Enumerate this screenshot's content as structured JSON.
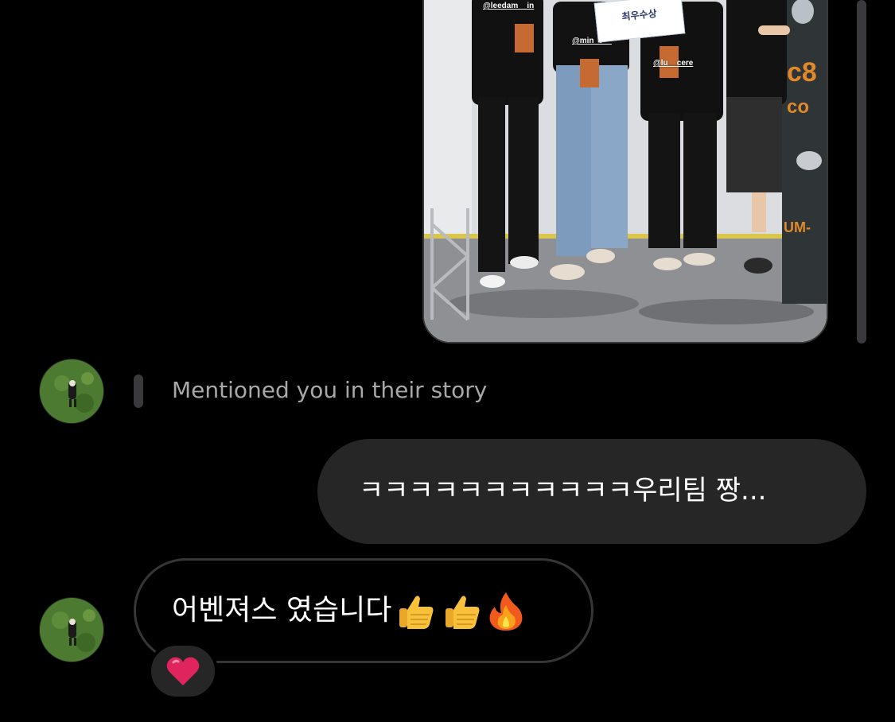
{
  "story": {
    "tags": [
      "@leedam__in",
      "@min_0__",
      "@lu__cere"
    ],
    "sign_text": "최우수상"
  },
  "mention": {
    "text": "Mentioned you in their story"
  },
  "messages": {
    "outgoing_text": "ㅋㅋㅋㅋㅋㅋㅋㅋㅋㅋㅋ우리팀 짱...",
    "incoming_text": "어벤져스 였습니다",
    "incoming_emojis": [
      "thumbs-up-icon",
      "thumbs-up-icon",
      "fire-icon"
    ],
    "reaction": "heart-icon"
  },
  "colors": {
    "background": "#000000",
    "bubble_out": "#262626",
    "bubble_in_border": "#363636",
    "secondary_text": "#a8a8a8",
    "reaction_heart": "#e0245e"
  }
}
